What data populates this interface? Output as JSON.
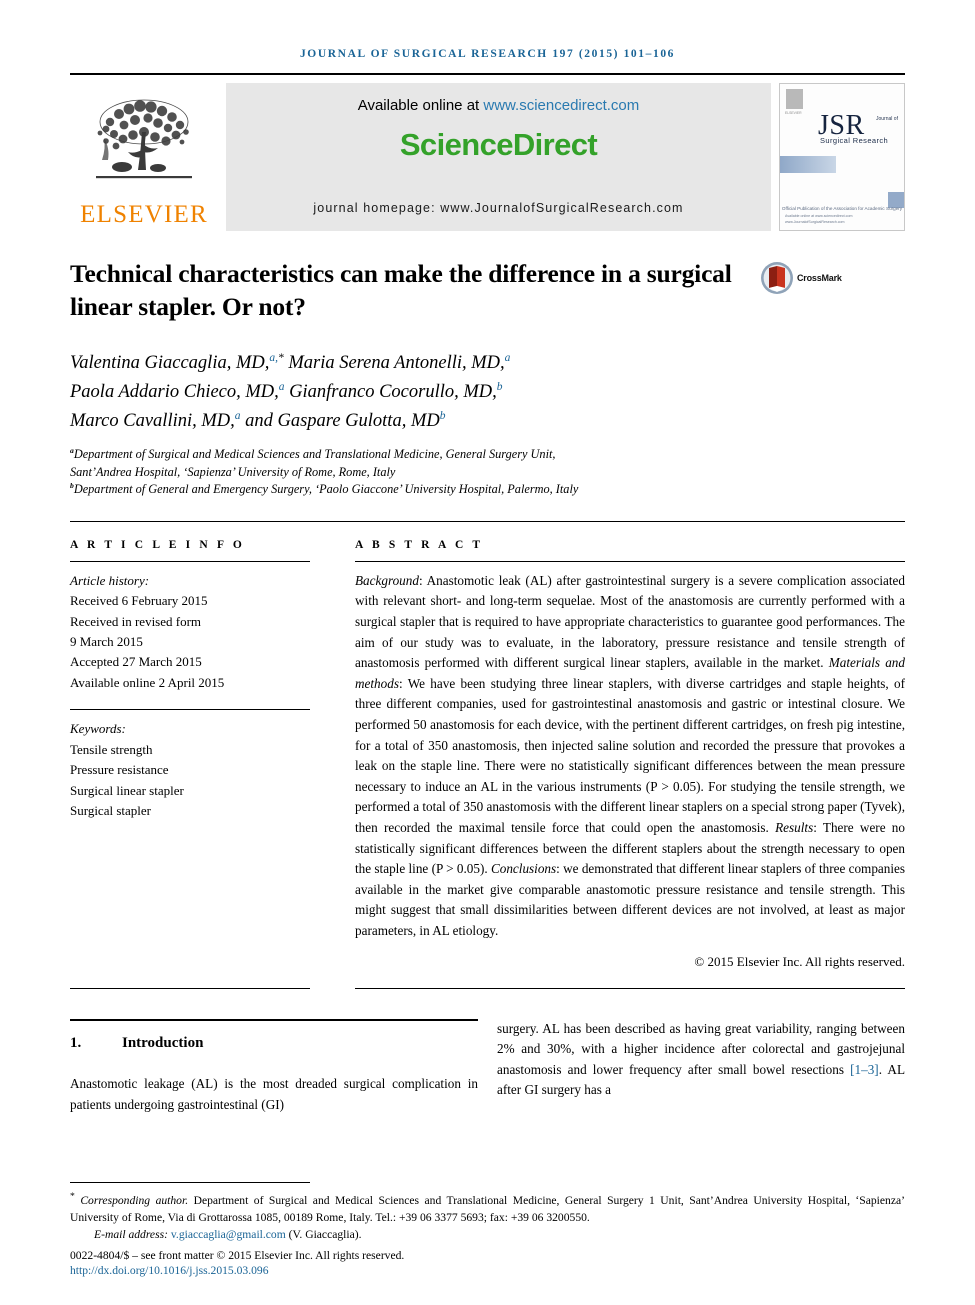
{
  "running_head": "JOURNAL OF SURGICAL RESEARCH 197 (2015) 101–106",
  "masthead": {
    "publisher_name": "ELSEVIER",
    "available_prefix": "Available online at ",
    "sciencedirect_url": "www.sciencedirect.com",
    "sciencedirect_logo": "ScienceDirect",
    "journal_homepage": "journal homepage: www.JournalofSurgicalResearch.com",
    "cover": {
      "acronym": "JSR",
      "acronym_sub": "Journal of",
      "acronym_sub2": "Surgical Research",
      "association_line": "Official Publication of the\nAssociation for Academic Surgery",
      "footer_line": "Available online at www.sciencedirect.com\nwww.JournalofSurgicalResearch.com"
    }
  },
  "title": "Technical characteristics can make the difference in a surgical linear stapler. Or not?",
  "crossmark": {
    "label": "CrossMark"
  },
  "authors_html": "Valentina Giaccaglia, MD,<sup>a,<span class=\"star\">*</span></sup> Maria Serena Antonelli, MD,<sup>a</sup><br>Paola Addario Chieco, MD,<sup>a</sup> Gianfranco Cocorullo, MD,<sup>b</sup><br>Marco Cavallini, MD,<sup>a</sup> and Gaspare Gulotta, MD<sup>b</sup>",
  "affiliations_html": "<sup>a</sup>Department of Surgical and Medical Sciences and Translational Medicine, General Surgery Unit,<br>Sant’Andrea Hospital, ‘Sapienza’ University of Rome, Rome, Italy<br><sup>b</sup>Department of General and Emergency Surgery, ‘Paolo Giaccone’ University Hospital, Palermo, Italy",
  "article_info": {
    "heading": "A R T I C L E   I N F O",
    "history_label": "Article history:",
    "history": [
      "Received 6 February 2015",
      "Received in revised form",
      "9 March 2015",
      "Accepted 27 March 2015",
      "Available online 2 April 2015"
    ],
    "keywords_label": "Keywords:",
    "keywords": [
      "Tensile strength",
      "Pressure resistance",
      "Surgical linear stapler",
      "Surgical stapler"
    ]
  },
  "abstract": {
    "heading": "A B S T R A C T",
    "sections": [
      {
        "lead": "Background",
        "text": ": Anastomotic leak (AL) after gastrointestinal surgery is a severe complication associated with relevant short- and long-term sequelae. Most of the anastomosis are currently performed with a surgical stapler that is required to have appropriate characteristics to guarantee good performances. The aim of our study was to evaluate, in the laboratory, pressure resistance and tensile strength of anastomosis performed with different surgical linear staplers, available in the market."
      },
      {
        "lead": "Materials and methods",
        "text": ": We have been studying three linear staplers, with diverse cartridges and staple heights, of three different companies, used for gastrointestinal anastomosis and gastric or intestinal closure. We performed 50 anastomosis for each device, with the pertinent different cartridges, on fresh pig intestine, for a total of 350 anastomosis, then injected saline solution and recorded the pressure that provokes a leak on the staple line. There were no statistically significant differences between the mean pressure necessary to induce an AL in the various instruments (P > 0.05). For studying the tensile strength, we performed a total of 350 anastomosis with the different linear staplers on a special strong paper (Tyvek), then recorded the maximal tensile force that could open the anastomosis."
      },
      {
        "lead": "Results",
        "text": ": There were no statistically significant differences between the different staplers about the strength necessary to open the staple line (P > 0.05)."
      },
      {
        "lead": "Conclusions",
        "text": ": we demonstrated that different linear staplers of three companies available in the market give comparable anastomotic pressure resistance and tensile strength. This might suggest that small dissimilarities between different devices are not involved, at least as major parameters, in AL etiology."
      }
    ],
    "copyright": "© 2015 Elsevier Inc. All rights reserved."
  },
  "introduction": {
    "number": "1.",
    "heading": "Introduction",
    "column_left": "Anastomotic leakage (AL) is the most dreaded surgical complication in patients undergoing gastrointestinal (GI)",
    "column_right_part1": "surgery. AL has been described as having great variability, ranging between 2% and 30%, with a higher incidence after colorectal and gastrojejunal anastomosis and lower frequency after small bowel resections ",
    "column_right_ref": "[1–3]",
    "column_right_part2": ". AL after GI surgery has a"
  },
  "footnotes": {
    "corresponding_marker": "*",
    "corresponding_label": "Corresponding author.",
    "corresponding_text": " Department of Surgical and Medical Sciences and Translational Medicine, General Surgery 1 Unit, Sant’Andrea University Hospital, ‘Sapienza’ University of Rome, Via di Grottarossa 1085, 00189 Rome, Italy. Tel.: +39 06 3377 5693; fax: +39 06 3200550.",
    "email_label": "E-mail address:",
    "email": "v.giaccaglia@gmail.com",
    "email_owner": "(V. Giaccaglia).",
    "issn_line": "0022-4804/$ – see front matter © 2015 Elsevier Inc. All rights reserved.",
    "doi": "http://dx.doi.org/10.1016/j.jss.2015.03.096"
  },
  "colors": {
    "link_blue": "#1a6496",
    "sciencedirect_green": "#34a22a",
    "elsevier_orange": "#ef8200",
    "banner_gray": "#e7e7e7"
  }
}
